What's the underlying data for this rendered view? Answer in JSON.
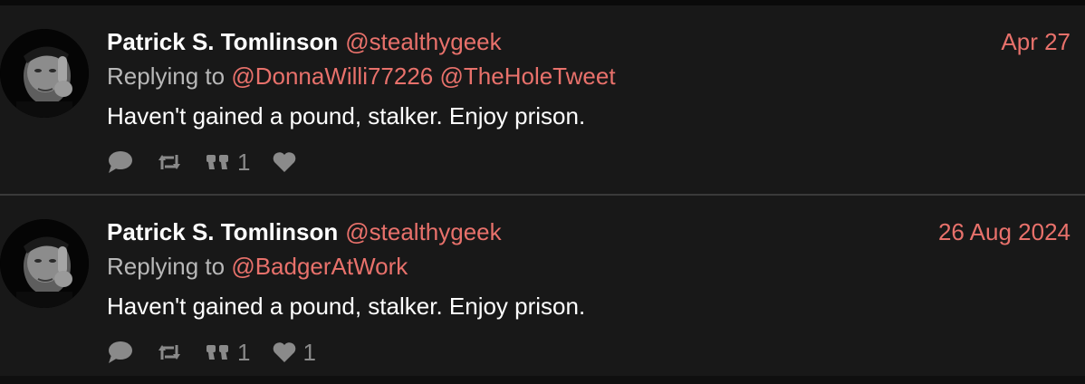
{
  "colors": {
    "background": "#181818",
    "link": "#e8716b",
    "text": "#ffffff",
    "muted": "#b8b8b8",
    "icon": "#8a8a8a"
  },
  "tweets": [
    {
      "display_name": "Patrick S. Tomlinson",
      "handle": "@stealthygeek",
      "date": "Apr 27",
      "replying_prefix": "Replying to",
      "mentions": [
        "@DonnaWilli77226",
        "@TheHoleTweet"
      ],
      "text": "Haven't gained a pound, stalker. Enjoy prison.",
      "actions": {
        "reply_icon": "reply-icon",
        "retweet_icon": "retweet-icon",
        "quote_icon": "quote-icon",
        "quote_count": "1",
        "like_icon": "heart-icon",
        "like_count": ""
      }
    },
    {
      "display_name": "Patrick S. Tomlinson",
      "handle": "@stealthygeek",
      "date": "26 Aug 2024",
      "replying_prefix": "Replying to",
      "mentions": [
        "@BadgerAtWork"
      ],
      "text": "Haven't gained a pound, stalker. Enjoy prison.",
      "actions": {
        "reply_icon": "reply-icon",
        "retweet_icon": "retweet-icon",
        "quote_icon": "quote-icon",
        "quote_count": "1",
        "like_icon": "heart-icon",
        "like_count": "1"
      }
    }
  ]
}
